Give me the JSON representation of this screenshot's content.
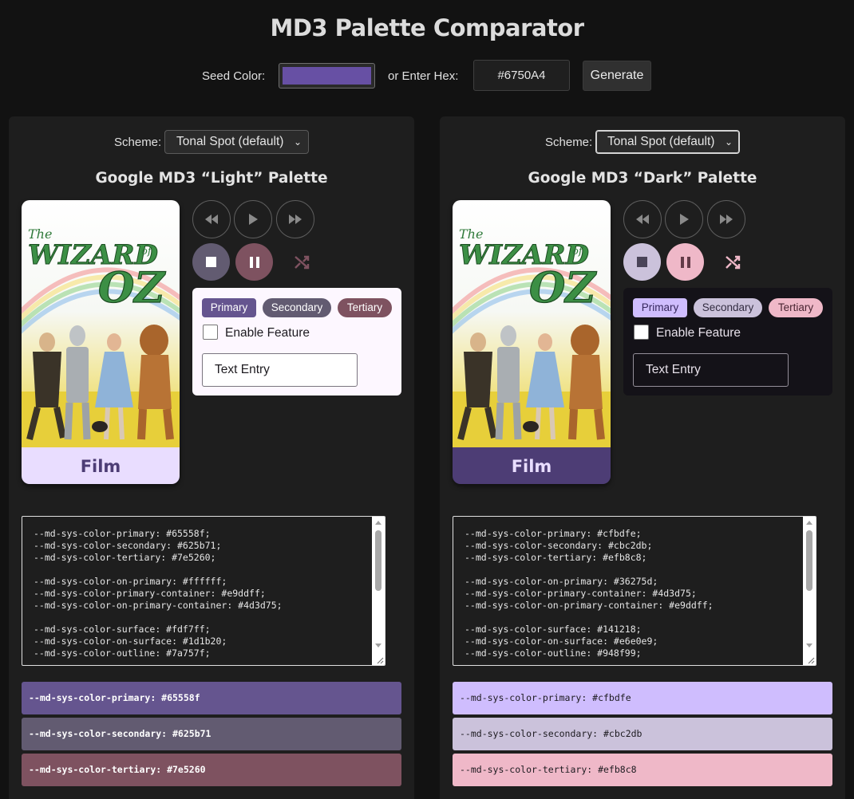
{
  "app": {
    "title": "MD3 Palette Comparator",
    "seed_label": "Seed Color:",
    "seed_color": "#6750A4",
    "hex_label": "or Enter Hex:",
    "hex_value": "#6750A4",
    "generate_label": "Generate"
  },
  "panels": {
    "light": {
      "scheme_label": "Scheme:",
      "scheme_value": "Tonal Spot (default)",
      "title": "Google MD3 “Light” Palette",
      "card_label": "Film",
      "chips": [
        "Primary",
        "Secondary",
        "Tertiary"
      ],
      "checkbox_label": "Enable Feature",
      "text_entry_placeholder": "Text Entry",
      "css_code": "--md-sys-color-primary: #65558f;\n--md-sys-color-secondary: #625b71;\n--md-sys-color-tertiary: #7e5260;\n\n--md-sys-color-on-primary: #ffffff;\n--md-sys-color-primary-container: #e9ddff;\n--md-sys-color-on-primary-container: #4d3d75;\n\n--md-sys-color-surface: #fdf7ff;\n--md-sys-color-on-surface: #1d1b20;\n--md-sys-color-outline: #7a757f;",
      "swatches": [
        {
          "text": "--md-sys-color-primary: #65558f",
          "color": "#65558f"
        },
        {
          "text": "--md-sys-color-secondary: #625b71",
          "color": "#625b71"
        },
        {
          "text": "--md-sys-color-tertiary: #7e5260",
          "color": "#7e5260"
        }
      ]
    },
    "dark": {
      "scheme_label": "Scheme:",
      "scheme_value": "Tonal Spot (default)",
      "title": "Google MD3 “Dark” Palette",
      "card_label": "Film",
      "chips": [
        "Primary",
        "Secondary",
        "Tertiary"
      ],
      "checkbox_label": "Enable Feature",
      "text_entry_placeholder": "Text Entry",
      "css_code": "--md-sys-color-primary: #cfbdfe;\n--md-sys-color-secondary: #cbc2db;\n--md-sys-color-tertiary: #efb8c8;\n\n--md-sys-color-on-primary: #36275d;\n--md-sys-color-primary-container: #4d3d75;\n--md-sys-color-on-primary-container: #e9ddff;\n\n--md-sys-color-surface: #141218;\n--md-sys-color-on-surface: #e6e0e9;\n--md-sys-color-outline: #948f99;",
      "swatches": [
        {
          "text": "--md-sys-color-primary: #cfbdfe",
          "color": "#cfbdfe"
        },
        {
          "text": "--md-sys-color-secondary: #cbc2db",
          "color": "#cbc2db"
        },
        {
          "text": "--md-sys-color-tertiary: #efb8c8",
          "color": "#efb8c8"
        }
      ]
    }
  },
  "poster": {
    "title_line1": "The",
    "title_line2": "WIZARD",
    "title_line3": "of",
    "title_line4": "OZ"
  }
}
